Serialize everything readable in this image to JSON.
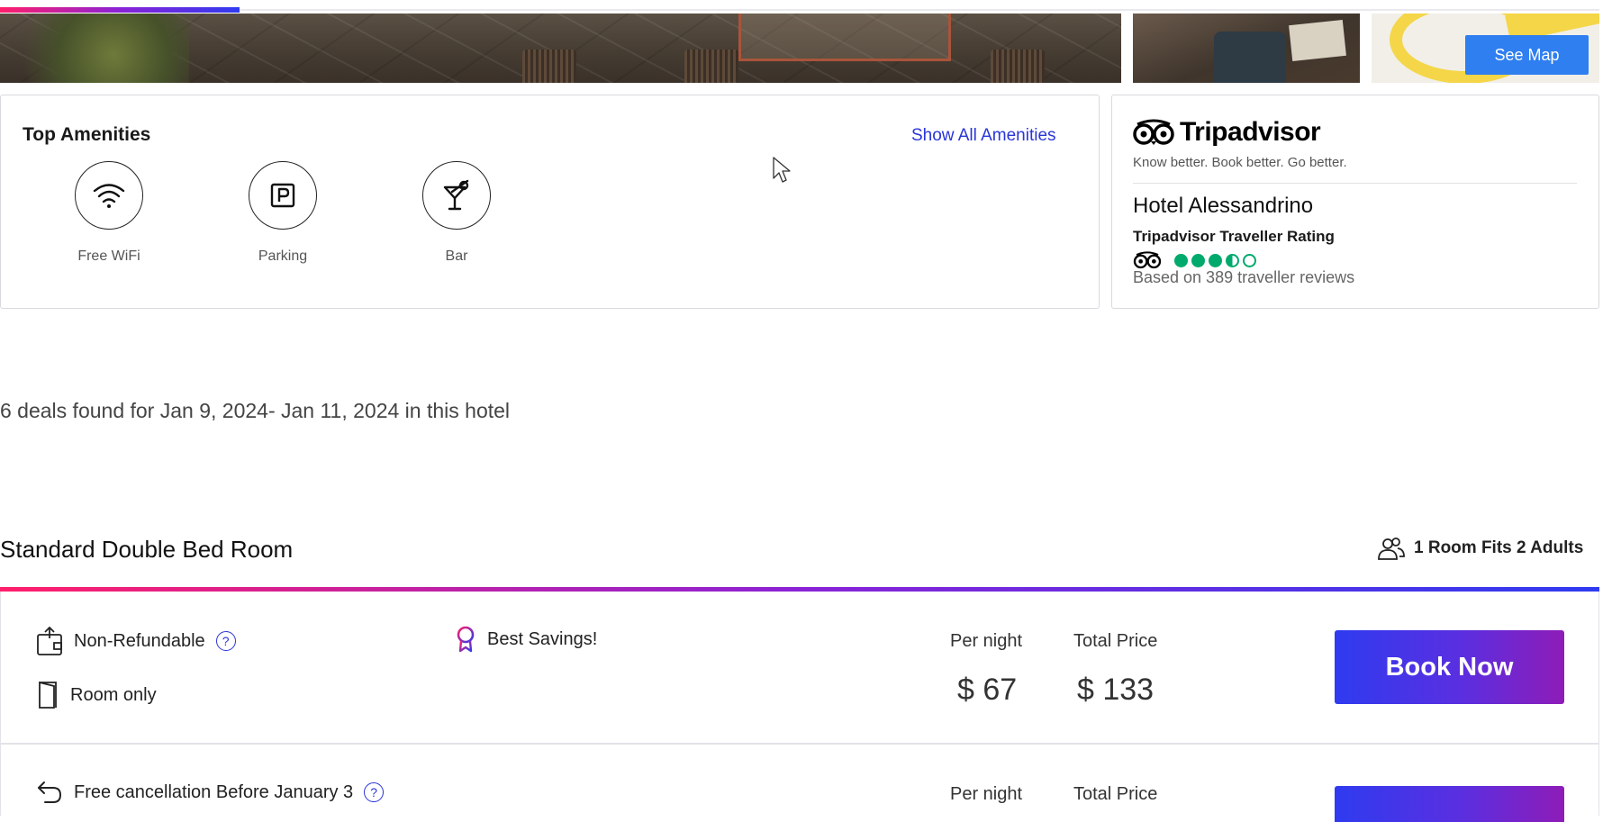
{
  "gallery": {
    "see_map_label": "See Map",
    "progress_fraction": 0.15
  },
  "amenities": {
    "title": "Top Amenities",
    "show_all_label": "Show All Amenities",
    "items": [
      {
        "label": "Free WiFi",
        "icon": "wifi-icon"
      },
      {
        "label": "Parking",
        "icon": "parking-icon"
      },
      {
        "label": "Bar",
        "icon": "cocktail-icon"
      }
    ]
  },
  "tripadvisor": {
    "brand": "Tripadvisor",
    "tagline": "Know better. Book better. Go better.",
    "hotel_name": "Hotel Alessandrino",
    "rating_label": "Tripadvisor Traveller Rating",
    "rating_value": 3.5,
    "rating_max": 5,
    "reviews_text": "Based on 389 traveller reviews",
    "brand_color": "#00aa6c"
  },
  "deals_summary": "6 deals found for Jan 9, 2024- Jan 11, 2024 in this hotel",
  "room": {
    "name": "Standard Double Bed Room",
    "fits_label": "1 Room Fits 2 Adults",
    "offers": [
      {
        "policy": "Non-Refundable",
        "board": "Room only",
        "badge": "Best Savings!",
        "per_night_label": "Per night",
        "per_night_price": "$ 67",
        "total_label": "Total Price",
        "total_price": "$ 133",
        "book_label": "Book Now"
      },
      {
        "policy": "Free cancellation Before January 3",
        "per_night_label": "Per night",
        "total_label": "Total Price"
      }
    ]
  },
  "colors": {
    "accent_blue": "#2a35d8",
    "gradient_start": "#ff1f6b",
    "gradient_end": "#2f3bf0",
    "map_button": "#2f7ff0"
  }
}
